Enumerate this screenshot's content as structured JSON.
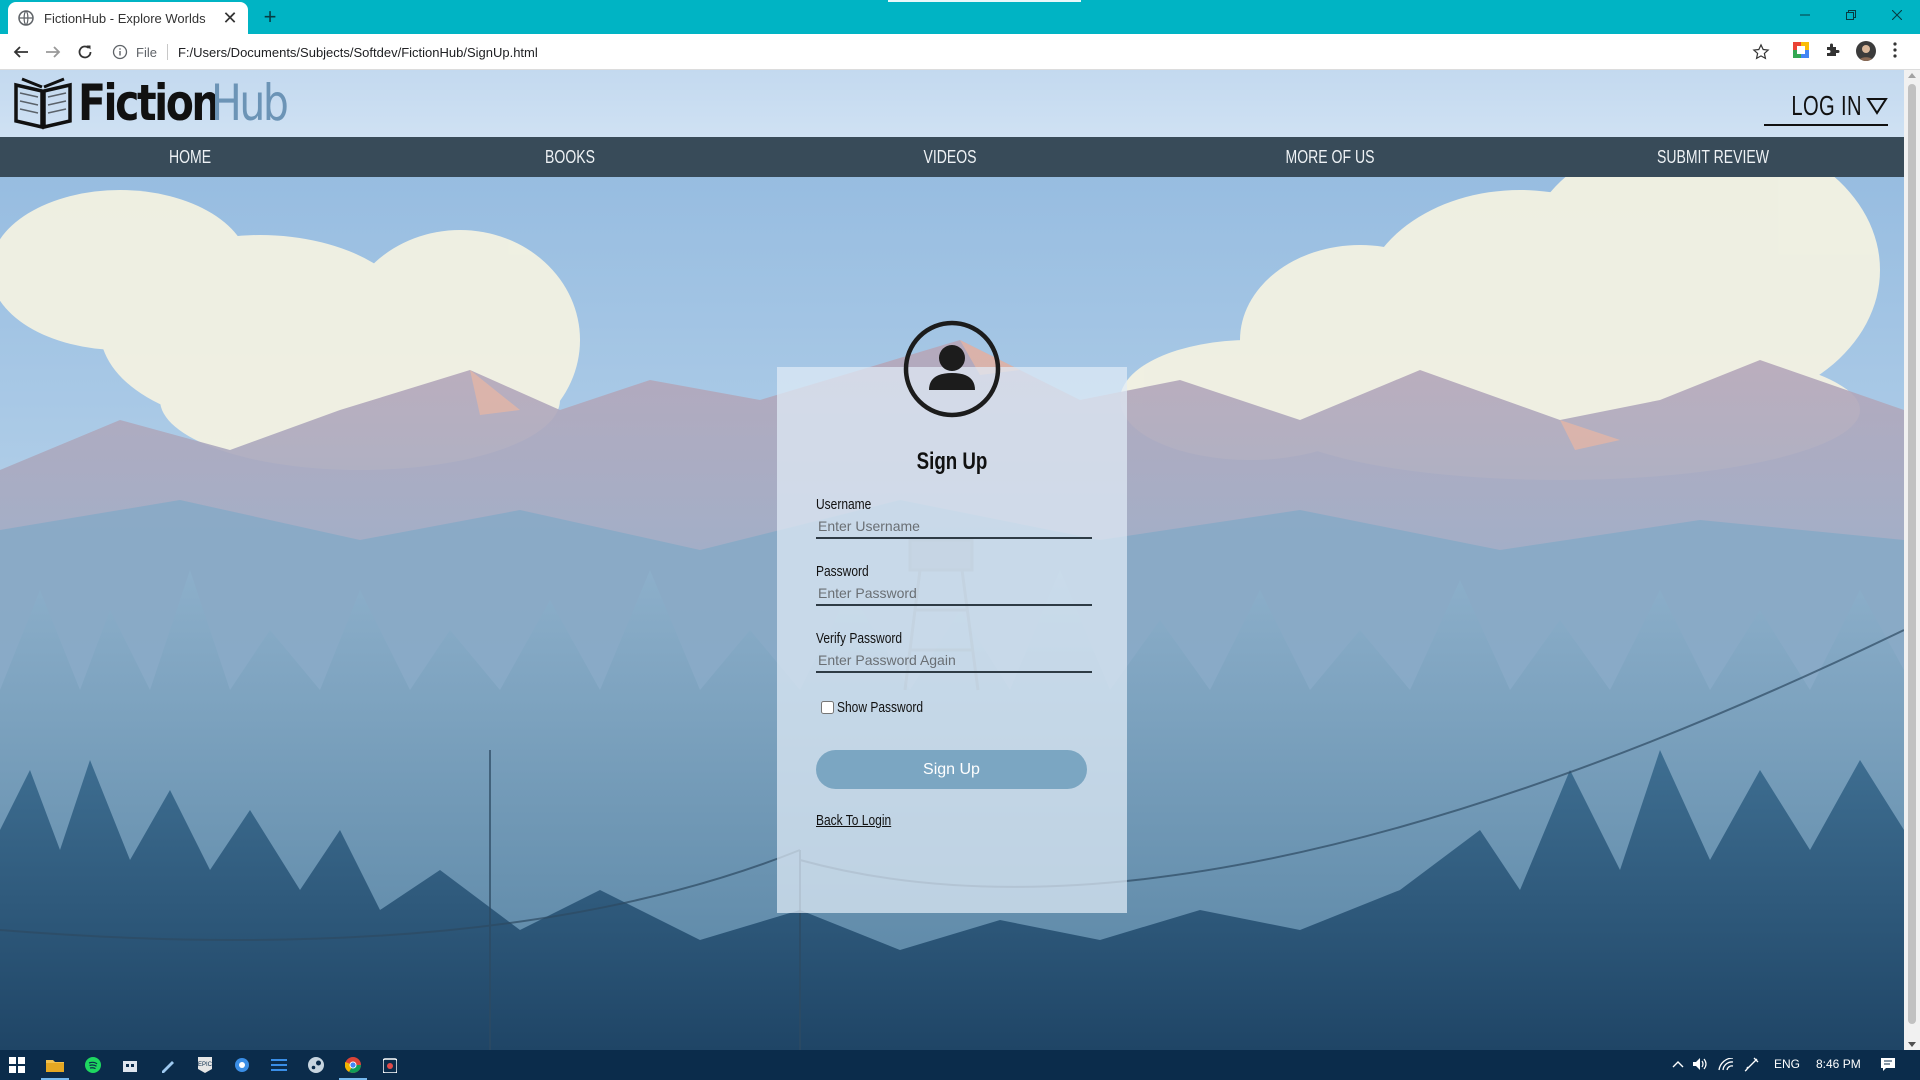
{
  "browser": {
    "tab_title": "FictionHub - Explore Worlds",
    "tab_close": "✕",
    "new_tab": "+",
    "url_scheme": "File",
    "url": "F:/Users/Documents/Subjects/Softdev/FictionHub/SignUp.html",
    "accent": "#00b4c4"
  },
  "site": {
    "logo_word1": "Fiction",
    "logo_word2": "Hub",
    "login_label": "LOG IN",
    "nav": [
      "HOME",
      "BOOKS",
      "VIDEOS",
      "MORE OF US",
      "SUBMIT REVIEW"
    ],
    "nav_color": "#384b59"
  },
  "form": {
    "title": "Sign Up",
    "username_label": "Username",
    "username_placeholder": "Enter Username",
    "password_label": "Password",
    "password_placeholder": "Enter Password",
    "verify_label": "Verify Password",
    "verify_placeholder": "Enter Password Again",
    "show_password_label": "Show Password",
    "show_password_checked": false,
    "submit_label": "Sign Up",
    "back_link": "Back To Login",
    "button_color": "#7ba6c2"
  },
  "taskbar": {
    "language": "ENG",
    "time": "8:46 PM",
    "icons": [
      "windows-start-icon",
      "file-explorer-icon",
      "spotify-icon",
      "store-icon",
      "pen-app-icon",
      "epic-games-icon",
      "browser-icon",
      "task-app-icon",
      "steam-icon",
      "chrome-icon",
      "media-app-icon"
    ]
  }
}
